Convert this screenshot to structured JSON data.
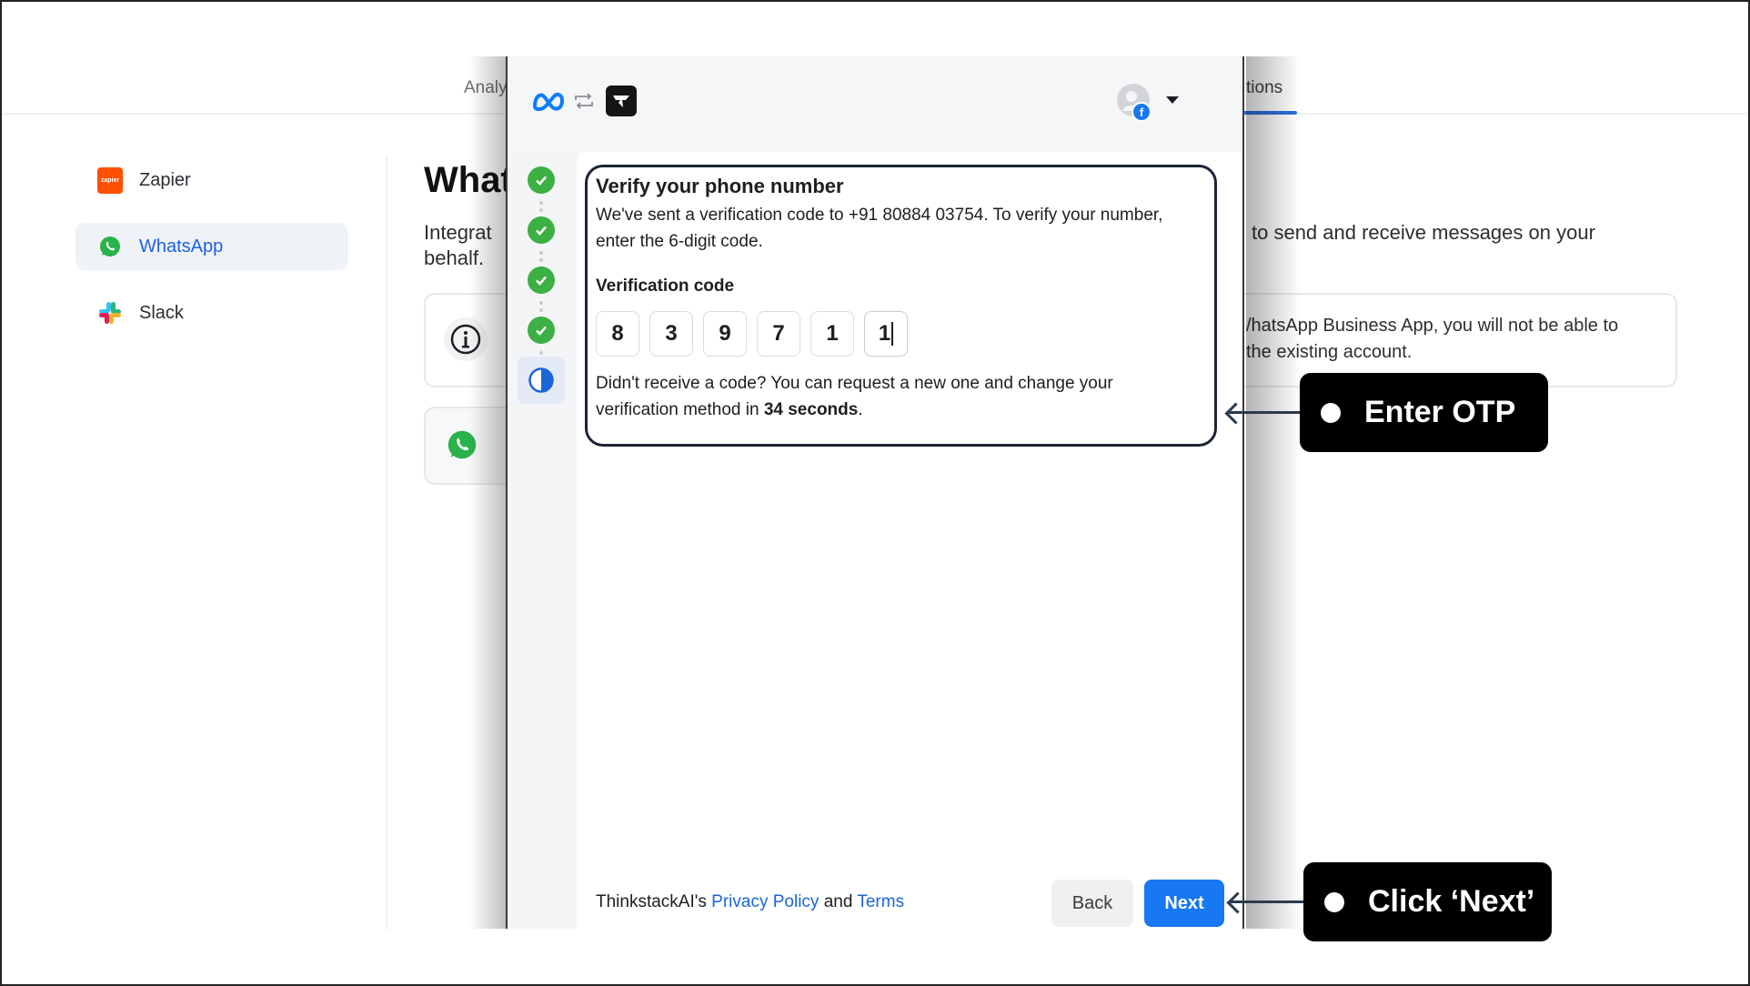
{
  "background_app": {
    "tabs": [
      {
        "label": "Analy",
        "active": false
      },
      {
        "label": "tions",
        "active": true
      }
    ],
    "sidebar": {
      "items": [
        {
          "label": "Zapier",
          "icon": "zapier-logo-icon",
          "icon_text": "zapier",
          "active": false
        },
        {
          "label": "WhatsApp",
          "icon": "whatsapp-icon",
          "active": true
        },
        {
          "label": "Slack",
          "icon": "slack-icon",
          "active": false
        }
      ]
    },
    "page_title": "What",
    "description_left_line1": "Integrat",
    "description_left_line2": "behalf.",
    "description_right": "to send and receive messages on your",
    "info_card_text_line1": "/hatsApp Business App, you will not be able to",
    "info_card_text_line2": "the existing account."
  },
  "modal": {
    "header": {
      "meta_logo": "meta-logo-icon",
      "swap_icon": "swap-arrows-icon",
      "app_logo": "thinkstack-logo-icon",
      "account_caret": "caret-down-icon"
    },
    "steps": [
      {
        "status": "complete"
      },
      {
        "status": "complete"
      },
      {
        "status": "complete"
      },
      {
        "status": "complete"
      },
      {
        "status": "in-progress"
      }
    ],
    "verify": {
      "title": "Verify your phone number",
      "body": "We've sent a verification code to +91 80884 03754. To verify your number, enter the 6-digit code.",
      "code_label": "Verification code",
      "otp_digits": [
        "8",
        "3",
        "9",
        "7",
        "1",
        "1"
      ],
      "resend_prefix": "Didn't receive a code? You can request a new one and change your verification method in ",
      "resend_countdown": "34 seconds",
      "resend_suffix": "."
    },
    "footer": {
      "company": "ThinkstackAI's ",
      "privacy_link": "Privacy Policy",
      "and": " and ",
      "terms_link": "Terms",
      "back_label": "Back",
      "next_label": "Next"
    }
  },
  "annotations": {
    "enter_otp": "Enter OTP",
    "click_next": "Click ‘Next’"
  },
  "colors": {
    "primary_blue": "#1877f2",
    "step_green": "#3cb043",
    "sidebar_active_text": "#1f5fe0",
    "callout_bg": "#000000"
  }
}
